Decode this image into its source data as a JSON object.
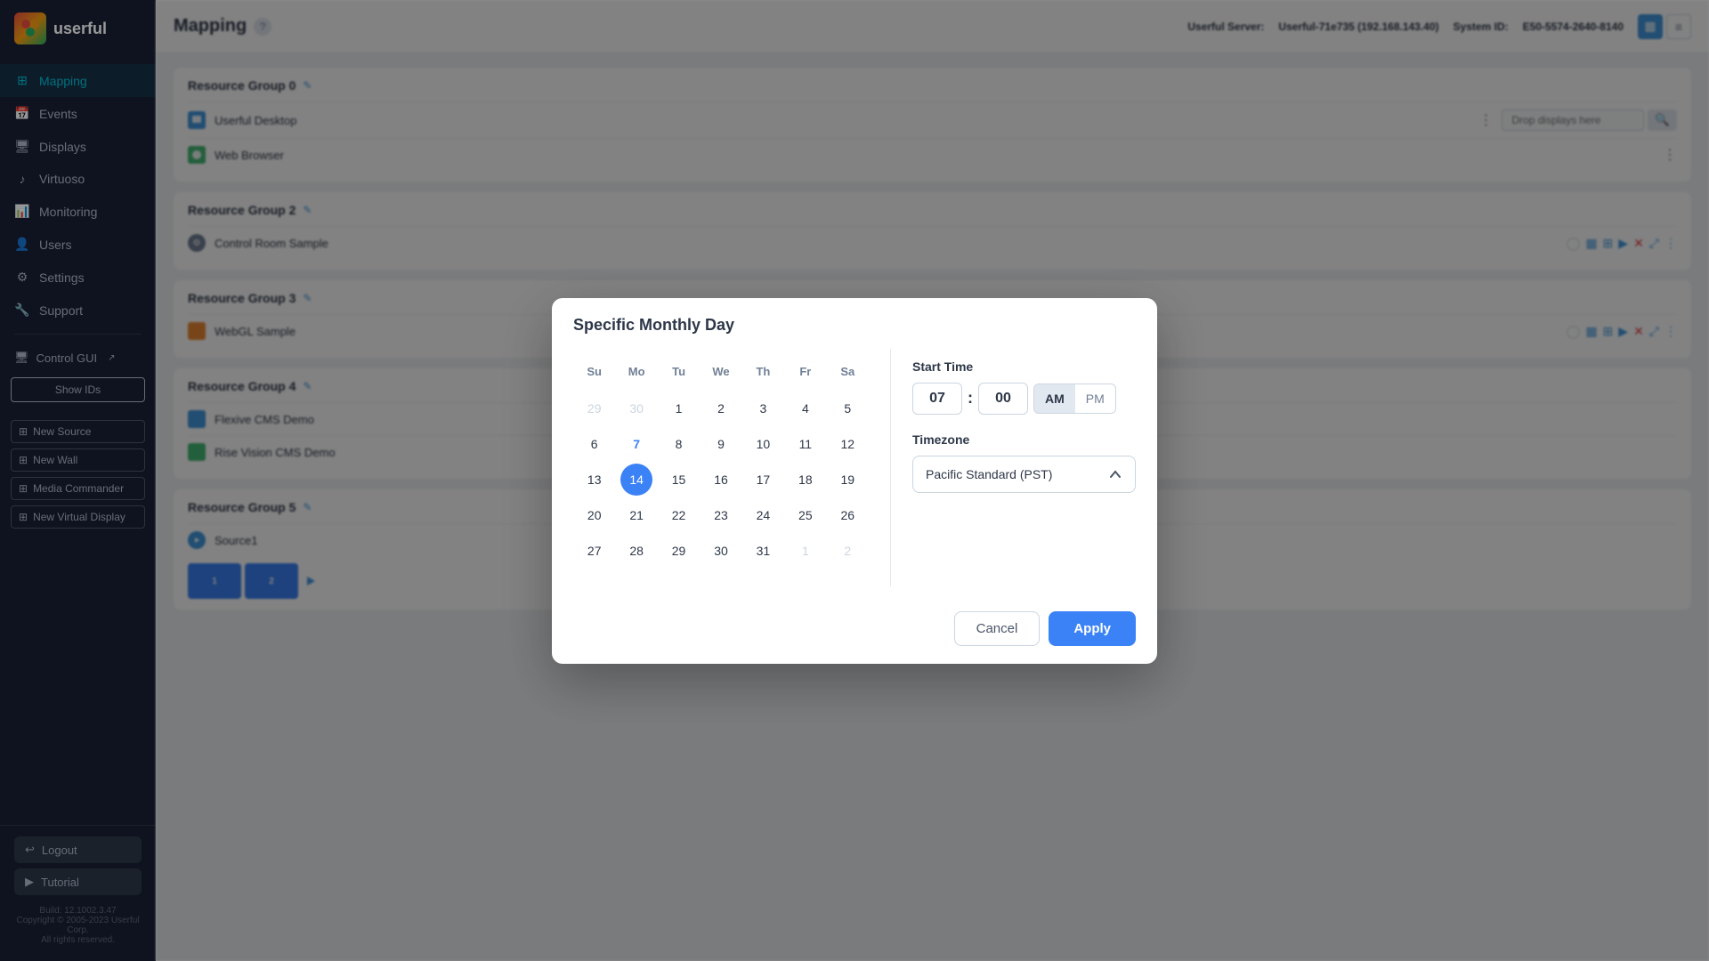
{
  "app": {
    "logo": "🎯",
    "logo_text": "userful"
  },
  "sidebar": {
    "items": [
      {
        "id": "mapping",
        "label": "Mapping",
        "icon": "⊞",
        "active": true
      },
      {
        "id": "events",
        "label": "Events",
        "icon": "📅",
        "active": false
      },
      {
        "id": "displays",
        "label": "Displays",
        "icon": "🖥",
        "active": false
      },
      {
        "id": "virtuoso",
        "label": "Virtuoso",
        "icon": "🎵",
        "active": false
      },
      {
        "id": "monitoring",
        "label": "Monitoring",
        "icon": "📊",
        "active": false
      },
      {
        "id": "users",
        "label": "Users",
        "icon": "👤",
        "active": false
      },
      {
        "id": "settings",
        "label": "Settings",
        "icon": "⚙",
        "active": false
      },
      {
        "id": "support",
        "label": "Support",
        "icon": "🔧",
        "active": false
      }
    ],
    "control_gui_label": "Control GUI",
    "show_ids_label": "Show IDs",
    "actions": [
      {
        "label": "New Source"
      },
      {
        "label": "New Wall"
      },
      {
        "label": "Media Commander"
      },
      {
        "label": "New Virtual Display"
      }
    ],
    "logout_label": "Logout",
    "tutorial_label": "Tutorial",
    "build_text": "Build: 12.1002.3.47\nCopyright © 2005-2023 Userful Corp.\nAll rights reserved."
  },
  "topbar": {
    "title": "Mapping",
    "help_icon": "?",
    "server_label": "Userful Server:",
    "server_value": "Userful-71e735 (192.168.143.40)",
    "system_id_label": "System ID:",
    "system_id_value": "E50-5574-2640-8140"
  },
  "resource_groups": [
    {
      "id": 1,
      "title": "Resource Group 0",
      "items": [
        {
          "name": "Userful Desktop",
          "icon_color": "#4299e1"
        },
        {
          "name": "Web Browser",
          "icon_color": "#48bb78"
        }
      ],
      "placeholder": "Drop displays here"
    },
    {
      "id": 2,
      "title": "Resource Group 2",
      "items": [
        {
          "name": "Control Room Sample",
          "icon_color": "#718096"
        }
      ]
    },
    {
      "id": 3,
      "title": "Resource Group 3",
      "items": [
        {
          "name": "WebGL Sample",
          "icon_color": "#ed8936"
        }
      ]
    },
    {
      "id": 4,
      "title": "Resource Group 4",
      "items": [
        {
          "name": "Flexive CMS Demo",
          "icon_color": "#4299e1"
        },
        {
          "name": "Rise Vision CMS Demo",
          "icon_color": "#48bb78"
        }
      ]
    },
    {
      "id": 5,
      "title": "Resource Group 5",
      "items": [
        {
          "name": "Source1",
          "icon_color": "#4299e1"
        }
      ]
    }
  ],
  "modal": {
    "title": "Specific Monthly Day",
    "calendar": {
      "day_headers": [
        "Su",
        "Mo",
        "Tu",
        "We",
        "Th",
        "Fr",
        "Sa"
      ],
      "weeks": [
        [
          {
            "day": "29",
            "type": "other-month"
          },
          {
            "day": "30",
            "type": "other-month"
          },
          {
            "day": "1",
            "type": "normal"
          },
          {
            "day": "2",
            "type": "normal"
          },
          {
            "day": "3",
            "type": "normal"
          },
          {
            "day": "4",
            "type": "normal"
          },
          {
            "day": "5",
            "type": "normal"
          }
        ],
        [
          {
            "day": "6",
            "type": "normal"
          },
          {
            "day": "7",
            "type": "highlighted"
          },
          {
            "day": "8",
            "type": "normal"
          },
          {
            "day": "9",
            "type": "normal"
          },
          {
            "day": "10",
            "type": "normal"
          },
          {
            "day": "11",
            "type": "normal"
          },
          {
            "day": "12",
            "type": "normal"
          }
        ],
        [
          {
            "day": "13",
            "type": "normal"
          },
          {
            "day": "14",
            "type": "selected"
          },
          {
            "day": "15",
            "type": "normal"
          },
          {
            "day": "16",
            "type": "normal"
          },
          {
            "day": "17",
            "type": "normal"
          },
          {
            "day": "18",
            "type": "normal"
          },
          {
            "day": "19",
            "type": "normal"
          }
        ],
        [
          {
            "day": "20",
            "type": "normal"
          },
          {
            "day": "21",
            "type": "normal"
          },
          {
            "day": "22",
            "type": "normal"
          },
          {
            "day": "23",
            "type": "normal"
          },
          {
            "day": "24",
            "type": "normal"
          },
          {
            "day": "25",
            "type": "normal"
          },
          {
            "day": "26",
            "type": "normal"
          }
        ],
        [
          {
            "day": "27",
            "type": "normal"
          },
          {
            "day": "28",
            "type": "normal"
          },
          {
            "day": "29",
            "type": "normal"
          },
          {
            "day": "30",
            "type": "normal"
          },
          {
            "day": "31",
            "type": "normal"
          },
          {
            "day": "1",
            "type": "other-month"
          },
          {
            "day": "2",
            "type": "other-month"
          }
        ]
      ]
    },
    "start_time_label": "Start Time",
    "hour": "07",
    "minute": "00",
    "am_label": "AM",
    "pm_label": "PM",
    "active_ampm": "AM",
    "timezone_label": "Timezone",
    "timezone_value": "Pacific Standard (PST)",
    "cancel_label": "Cancel",
    "apply_label": "Apply"
  }
}
